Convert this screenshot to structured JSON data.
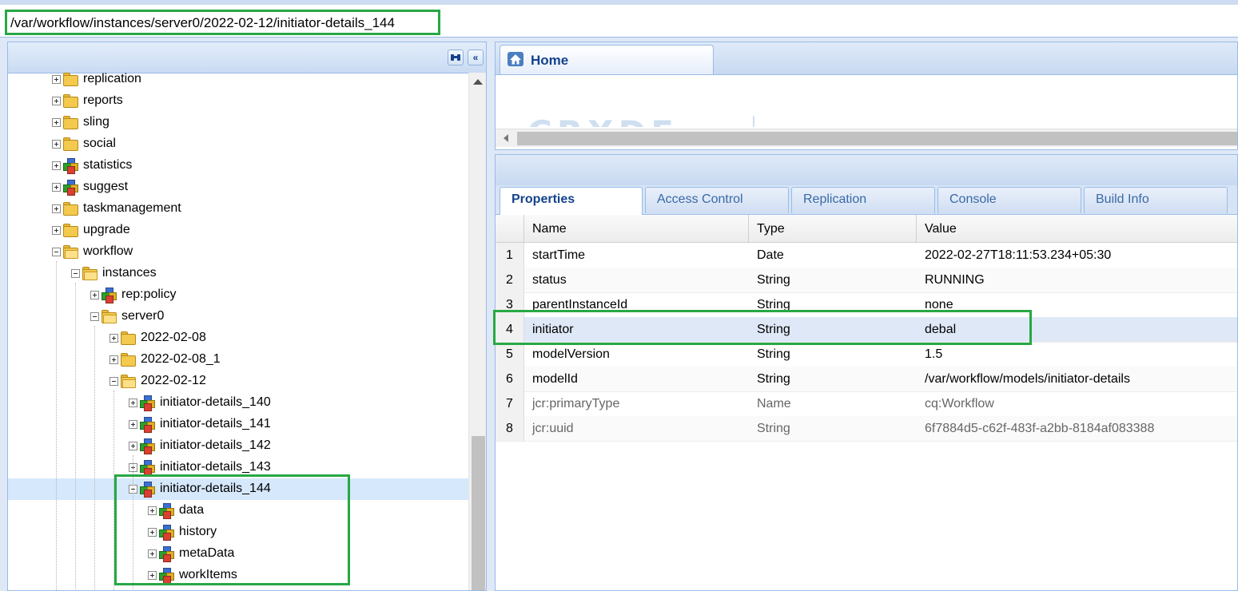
{
  "path_bar": {
    "value": "/var/workflow/instances/server0/2022-02-12/initiator-details_144"
  },
  "tree": {
    "nodes": [
      {
        "label": "replication",
        "kind": "folder",
        "state": "collapsed"
      },
      {
        "label": "reports",
        "kind": "folder",
        "state": "collapsed"
      },
      {
        "label": "sling",
        "kind": "folder",
        "state": "collapsed"
      },
      {
        "label": "social",
        "kind": "folder",
        "state": "collapsed"
      },
      {
        "label": "statistics",
        "kind": "node",
        "state": "collapsed"
      },
      {
        "label": "suggest",
        "kind": "node",
        "state": "collapsed"
      },
      {
        "label": "taskmanagement",
        "kind": "folder",
        "state": "collapsed"
      },
      {
        "label": "upgrade",
        "kind": "folder",
        "state": "collapsed"
      },
      {
        "label": "workflow",
        "kind": "folder",
        "state": "expanded"
      },
      {
        "label": "instances",
        "kind": "folder",
        "state": "expanded"
      },
      {
        "label": "rep:policy",
        "kind": "node",
        "state": "collapsed"
      },
      {
        "label": "server0",
        "kind": "folder",
        "state": "expanded"
      },
      {
        "label": "2022-02-08",
        "kind": "folder",
        "state": "collapsed"
      },
      {
        "label": "2022-02-08_1",
        "kind": "folder",
        "state": "collapsed"
      },
      {
        "label": "2022-02-12",
        "kind": "folder",
        "state": "expanded"
      },
      {
        "label": "initiator-details_140",
        "kind": "node",
        "state": "collapsed"
      },
      {
        "label": "initiator-details_141",
        "kind": "node",
        "state": "collapsed"
      },
      {
        "label": "initiator-details_142",
        "kind": "node",
        "state": "collapsed"
      },
      {
        "label": "initiator-details_143",
        "kind": "node",
        "state": "collapsed"
      },
      {
        "label": "initiator-details_144",
        "kind": "node",
        "state": "expanded",
        "selected": true
      },
      {
        "label": "data",
        "kind": "node",
        "state": "collapsed"
      },
      {
        "label": "history",
        "kind": "node",
        "state": "collapsed"
      },
      {
        "label": "metaData",
        "kind": "node",
        "state": "collapsed"
      },
      {
        "label": "workItems",
        "kind": "node",
        "state": "collapsed"
      }
    ]
  },
  "home_tab": {
    "label": "Home"
  },
  "props_tabs": [
    {
      "label": "Properties",
      "active": true
    },
    {
      "label": "Access Control"
    },
    {
      "label": "Replication"
    },
    {
      "label": "Console"
    },
    {
      "label": "Build Info"
    }
  ],
  "grid": {
    "columns": [
      "Name",
      "Type",
      "Value"
    ],
    "rows": [
      {
        "n": "1",
        "name": "startTime",
        "type": "Date",
        "value": "2022-02-27T18:11:53.234+05:30"
      },
      {
        "n": "2",
        "name": "status",
        "type": "String",
        "value": "RUNNING"
      },
      {
        "n": "3",
        "name": "parentInstanceId",
        "type": "String",
        "value": "none"
      },
      {
        "n": "4",
        "name": "initiator",
        "type": "String",
        "value": "debal",
        "highlight": true
      },
      {
        "n": "5",
        "name": "modelVersion",
        "type": "String",
        "value": "1.5"
      },
      {
        "n": "6",
        "name": "modelId",
        "type": "String",
        "value": "/var/workflow/models/initiator-details"
      },
      {
        "n": "7",
        "name": "jcr:primaryType",
        "type": "Name",
        "value": "cq:Workflow",
        "protected": true
      },
      {
        "n": "8",
        "name": "jcr:uuid",
        "type": "String",
        "value": "6f7884d5-c62f-483f-a2bb-8184af083388",
        "protected": true
      }
    ]
  },
  "colors": {
    "highlight_box": "#27a844",
    "panel_border": "#99bbe8",
    "tab_text": "#15428b"
  }
}
